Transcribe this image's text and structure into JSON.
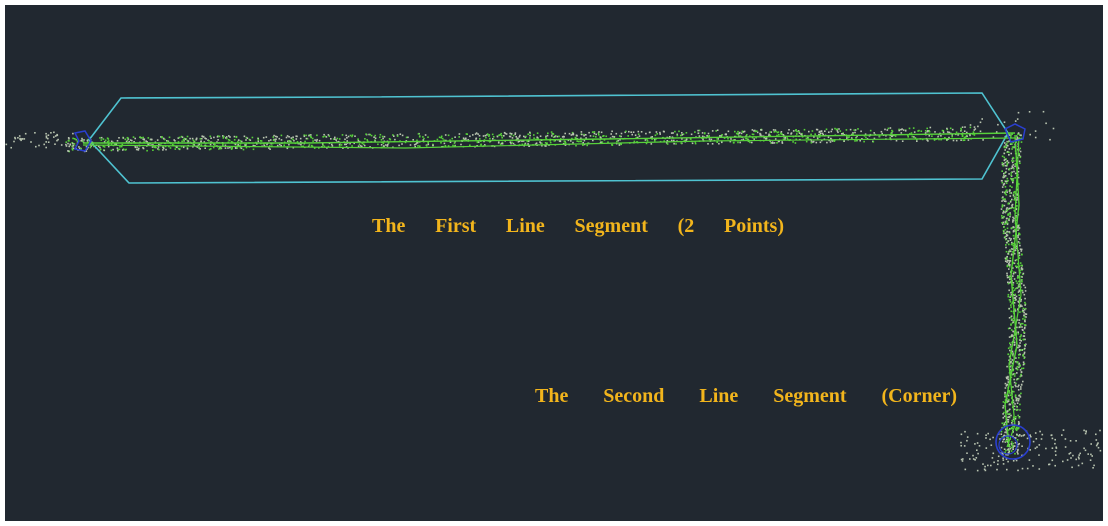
{
  "viewport": {
    "background": "#212830"
  },
  "colors": {
    "outline": "#4fc3d1",
    "path": "#57d13a",
    "points": "#b8c4b0",
    "markers": "#2a3fcf",
    "label": "#f2b51c"
  },
  "annotations": {
    "first_segment": "The First Line Segment (2 Points)",
    "second_segment": "The Second Line Segment (Corner)"
  },
  "icons": {
    "start_marker": "node-marker-icon",
    "corner_marker": "node-marker-icon",
    "end_marker": "circle-marker-icon"
  }
}
